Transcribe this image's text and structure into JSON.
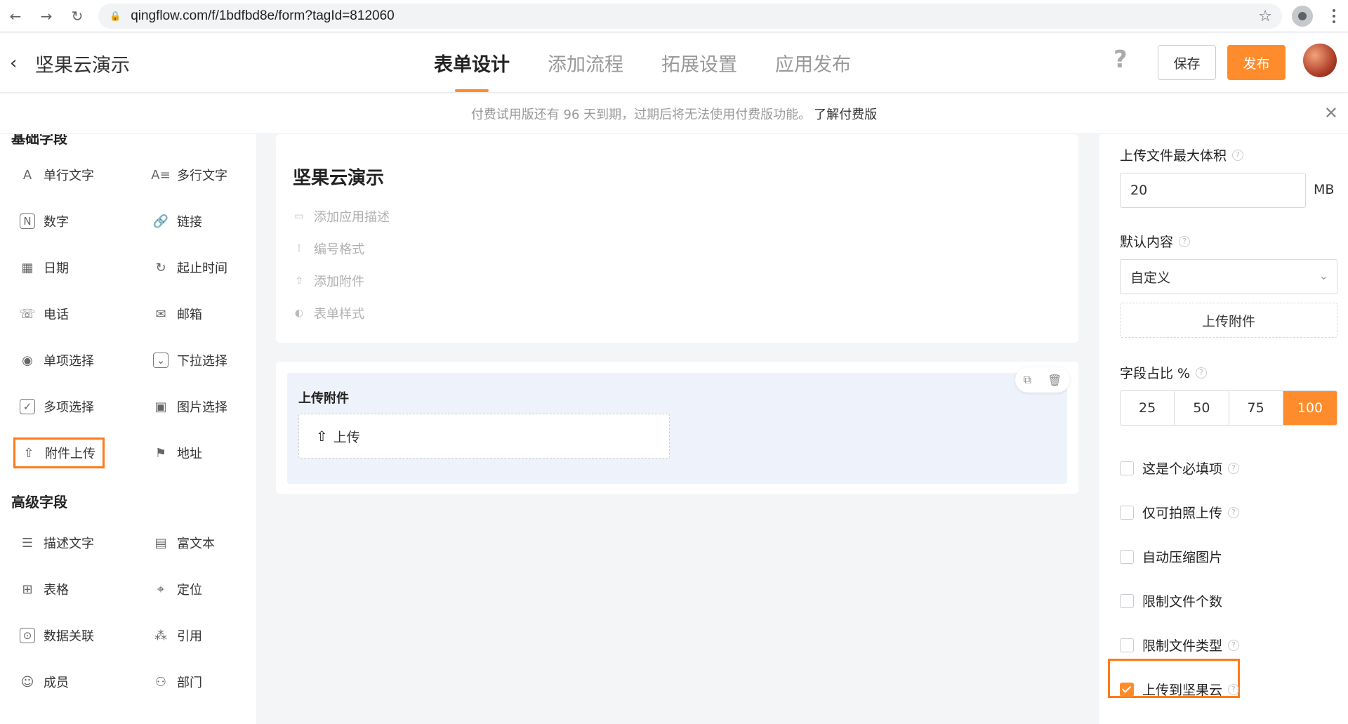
{
  "browser": {
    "url": "qingflow.com/f/1bdfbd8e/form?tagId=812060"
  },
  "header": {
    "back": "‹",
    "title": "坚果云演示",
    "tabs": [
      "表单设计",
      "添加流程",
      "拓展设置",
      "应用发布"
    ],
    "help": "?",
    "save_label": "保存",
    "publish_label": "发布"
  },
  "notice": {
    "text": "付费试用版还有 96 天到期，过期后将无法使用付费版功能。",
    "link": "了解付费版",
    "close": "✕"
  },
  "left": {
    "basic_title": "基础字段",
    "basic_fields": [
      {
        "label": "单行文字",
        "icon": "A"
      },
      {
        "label": "多行文字",
        "icon": "A≡"
      },
      {
        "label": "数字",
        "icon": "N"
      },
      {
        "label": "链接",
        "icon": "🔗"
      },
      {
        "label": "日期",
        "icon": "▦"
      },
      {
        "label": "起止时间",
        "icon": "↻"
      },
      {
        "label": "电话",
        "icon": "☏"
      },
      {
        "label": "邮箱",
        "icon": "✉"
      },
      {
        "label": "单项选择",
        "icon": "◉"
      },
      {
        "label": "下拉选择",
        "icon": "⌄"
      },
      {
        "label": "多项选择",
        "icon": "✓"
      },
      {
        "label": "图片选择",
        "icon": "▣"
      },
      {
        "label": "附件上传",
        "icon": "⇧"
      },
      {
        "label": "地址",
        "icon": "⚑"
      }
    ],
    "advanced_title": "高级字段",
    "advanced_fields": [
      {
        "label": "描述文字",
        "icon": "☰"
      },
      {
        "label": "富文本",
        "icon": "▤"
      },
      {
        "label": "表格",
        "icon": "⊞"
      },
      {
        "label": "定位",
        "icon": "⌖"
      },
      {
        "label": "数据关联",
        "icon": "⊙"
      },
      {
        "label": "引用",
        "icon": "⁂"
      },
      {
        "label": "成员",
        "icon": "☺"
      },
      {
        "label": "部门",
        "icon": "⚇"
      }
    ]
  },
  "canvas": {
    "title": "坚果云演示",
    "meta": [
      {
        "label": "添加应用描述",
        "icon": "▭"
      },
      {
        "label": "编号格式",
        "icon": "⁞"
      },
      {
        "label": "添加附件",
        "icon": "⇧"
      },
      {
        "label": "表单样式",
        "icon": "◐"
      }
    ],
    "field_label": "上传附件",
    "upload_text": "上传",
    "tool_copy": "⧉",
    "tool_delete": "🗑"
  },
  "right": {
    "max_size_label": "上传文件最大体积",
    "max_size_value": "20",
    "max_size_unit": "MB",
    "default_label": "默认内容",
    "default_value": "自定义",
    "upload_btn": "上传附件",
    "ratio_label": "字段占比 %",
    "ratio_options": [
      "25",
      "50",
      "75",
      "100"
    ],
    "ratio_selected": "100",
    "checkboxes": [
      {
        "label": "这是个必填项",
        "checked": false,
        "help": true
      },
      {
        "label": "仅可拍照上传",
        "checked": false,
        "help": true
      },
      {
        "label": "自动压缩图片",
        "checked": false,
        "help": false
      },
      {
        "label": "限制文件个数",
        "checked": false,
        "help": false
      },
      {
        "label": "限制文件类型",
        "checked": false,
        "help": true
      },
      {
        "label": "上传到坚果云",
        "checked": true,
        "help": true
      }
    ]
  },
  "colors": {
    "accent": "#ff8c2c"
  }
}
